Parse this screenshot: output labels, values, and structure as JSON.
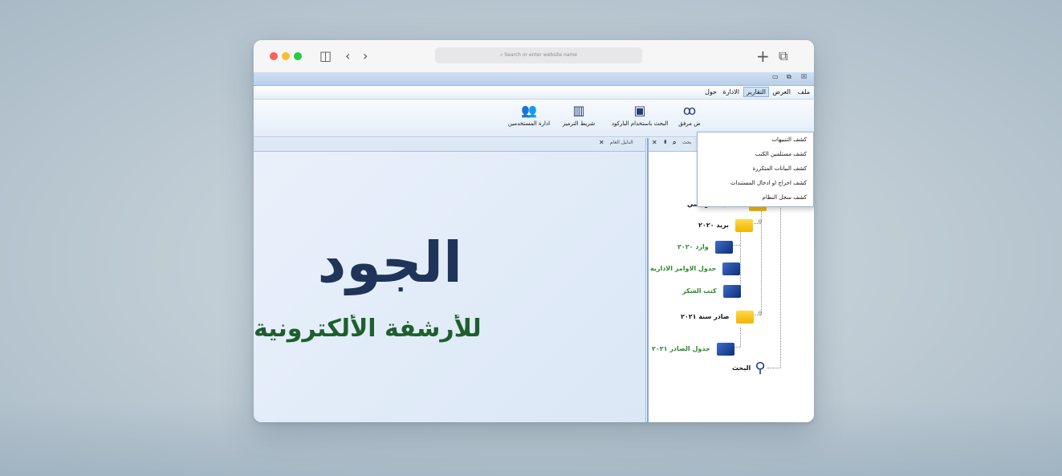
{
  "browser": {
    "address_placeholder": "Search or enter website name",
    "icons": [
      "sidebar-icon",
      "back-icon",
      "forward-icon",
      "new-tab-icon",
      "tabs-overview-icon"
    ]
  },
  "app": {
    "menu": [
      "ملف",
      "العرض",
      "التقارير",
      "الادارة",
      "حول"
    ],
    "active_menu": "التقارير",
    "toolbar": [
      {
        "label": "ادارة المستخدمين",
        "icon": "users-icon"
      },
      {
        "label": "شريط الترميز",
        "icon": "barcode-icon"
      },
      {
        "label": "البحث باستخدام الباركود",
        "icon": "barcode-scan-icon"
      },
      {
        "label": "ض مرفق",
        "icon": "binoculars-icon"
      }
    ],
    "reports_dropdown": [
      "كشف التنبيهات",
      "كشف مستلمين الكتب",
      "كشف البيانات المتكررة",
      "كشف اخراج او ادخال المستندات",
      "كشف سجل النظام"
    ],
    "tabs": {
      "main": "الدليل العام",
      "side": "بحث"
    },
    "brand": {
      "title": "الجود",
      "tagline": "للأرشفة الألكترونية"
    },
    "tree": {
      "root": "التصنيف الرئيسي",
      "mail": "بريد ٢٠٢٠",
      "incoming": "وارد ٢٠٢٠",
      "orders": "جدول الاوامر الادارية",
      "thanks": "كتب الشكر",
      "outgoing": "صادر سنة ٢٠٢١",
      "outgoing_table": "جدول الصادر ٢٠٢١",
      "search": "البحث"
    },
    "colors": {
      "brand_navy": "#1f3458",
      "brand_green": "#1f5e2e",
      "tree_green": "#2a8a2a"
    }
  }
}
